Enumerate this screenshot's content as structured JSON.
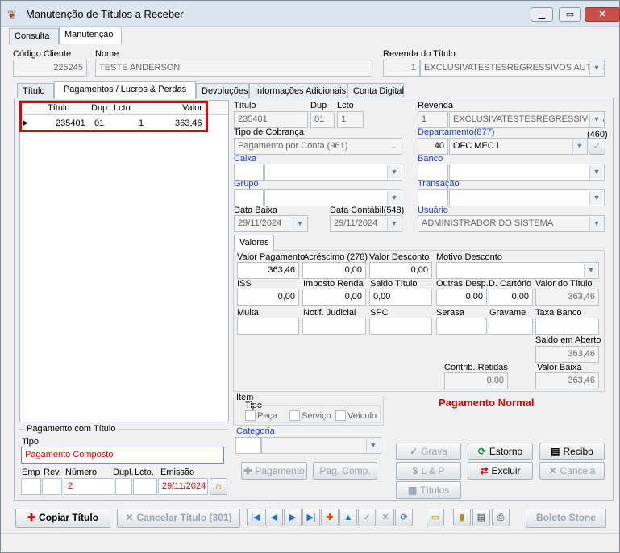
{
  "window": {
    "title": "Manutenção de Títulos a Receber",
    "min_label": "▁",
    "max_label": "▭",
    "close_label": "✕"
  },
  "top_tabs": [
    "Consulta",
    "Manutenção"
  ],
  "header": {
    "cod_cliente_label": "Código Cliente",
    "cod_cliente": "225245",
    "nome_label": "Nome",
    "nome": "TESTE ANDERSON",
    "revenda_label": "Revenda do Título",
    "revenda_num": "1",
    "revenda_nome": "EXCLUSIVATESTESREGRESSIVOS AUTOSHO"
  },
  "inner_tabs": [
    "Título",
    "Pagamentos / Lucros & Perdas",
    "Devoluções",
    "Informações Adicionais",
    "Conta Digital"
  ],
  "grid": {
    "headers": [
      "Título",
      "Dup",
      "Lcto",
      "Valor"
    ],
    "row": {
      "marker": "▶",
      "titulo": "235401",
      "dup": "01",
      "lcto": "1",
      "valor": "363,46"
    }
  },
  "pag_titulo": {
    "group_label": "Pagamento com Título",
    "tipo_label": "Tipo",
    "tipo": "Pagamento Composto",
    "emp_label": "Emp",
    "rev_label": "Rev.",
    "numero_label": "Número",
    "numero": "2",
    "dupl_label": "Dupl.",
    "lcto_label": "Lcto.",
    "emissao_label": "Emissão",
    "emissao": "29/11/2024"
  },
  "detail": {
    "titulo_label": "Título",
    "titulo": "235401",
    "dup_label": "Dup",
    "dup": "01",
    "lcto_label": "Lcto",
    "lcto": "1",
    "revenda_label": "Revenda",
    "revenda_num": "1",
    "revenda_nome": "EXCLUSIVATESTESREGRESSIVOS A",
    "tipo_cobranca_label": "Tipo de Cobrança",
    "tipo_cobranca": "Pagamento por Conta (961)",
    "departamento_label": "Departamento(877)",
    "dep_count": "(460)",
    "dep_num": "40",
    "dep_nome": "OFC MEC I",
    "caixa_label": "Caixa",
    "banco_label": "Banco",
    "grupo_label": "Grupo",
    "transacao_label": "Transação",
    "data_baixa_label": "Data Baixa",
    "data_baixa": "29/11/2024",
    "data_contabil_label": "Data Contábil(548)",
    "data_contabil": "29/11/2024",
    "usuario_label": "Usuário",
    "usuario": "ADMINISTRADOR DO SISTEMA"
  },
  "valores": {
    "tab": "Valores",
    "valor_pagamento_label": "Valor Pagamento",
    "valor_pagamento": "363,46",
    "acrescimo_label": "Acréscimo (278)",
    "acrescimo": "0,00",
    "valor_desconto_label": "Valor Desconto",
    "valor_desconto": "0,00",
    "motivo_desconto_label": "Motivo Desconto",
    "iss_label": "ISS",
    "iss": "0,00",
    "imposto_renda_label": "Imposto Renda",
    "imposto_renda": "0,00",
    "saldo_titulo_label": "Saldo Título",
    "saldo_titulo": "0,00",
    "outras_desp_label": "Outras Desp.",
    "outras_desp": "0,00",
    "d_cartorio_label": "D. Cartório",
    "d_cartorio": "0,00",
    "valor_titulo_label": "Valor do Título",
    "valor_titulo": "363,46",
    "multa_label": "Multa",
    "notif_label": "Notif. Judicial",
    "spc_label": "SPC",
    "serasa_label": "Serasa",
    "gravame_label": "Gravame",
    "taxa_banco_label": "Taxa Banco",
    "saldo_aberto_label": "Saldo em Aberto",
    "saldo_aberto": "363,46",
    "contrib_label": "Contrib. Retidas",
    "contrib": "0,00",
    "valor_baixa_label": "Valor Baixa",
    "valor_baixa": "363,46"
  },
  "item": {
    "label": "Item",
    "tipo_label": "Tipo",
    "peca": "Peça",
    "servico": "Serviço",
    "veiculo": "Veículo",
    "categoria_label": "Categoria"
  },
  "status": "Pagamento Normal",
  "buttons": {
    "pagamento": "Pagamento",
    "pag_comp": "Pag. Comp.",
    "grava": "Grava",
    "estorno": "Estorno",
    "recibo": "Recibo",
    "lp": "L & P",
    "excluir": "Excluir",
    "cancela": "Cancela",
    "titulos": "Títulos",
    "copiar": "Copiar Título",
    "cancelar_titulo": "Cancelar Título (301)",
    "boleto": "Boleto Stone"
  },
  "colors": {
    "accent_red": "#d00000",
    "label_blue": "#1a3fd0",
    "titlebar": "#dce6f1"
  }
}
